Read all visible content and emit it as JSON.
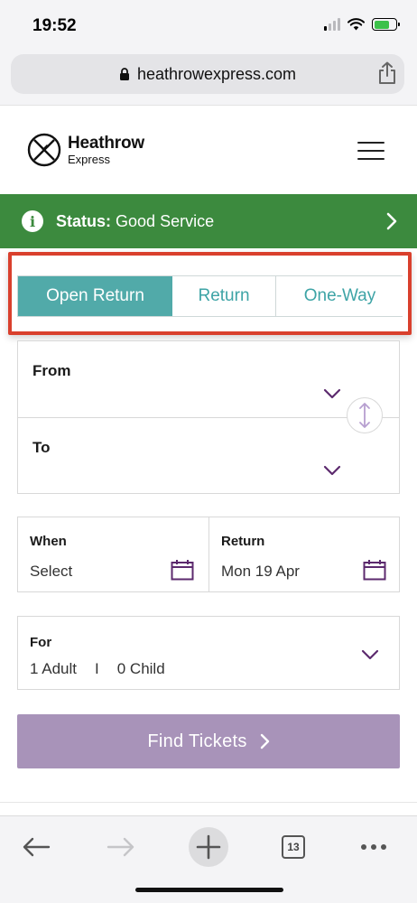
{
  "statusbar": {
    "time": "19:52"
  },
  "browser": {
    "url": "heathrowexpress.com",
    "tab_count": "13"
  },
  "header": {
    "logo_line1": "Heathrow",
    "logo_line2": "Express"
  },
  "status_banner": {
    "label": "Status:",
    "value": "Good Service",
    "color": "#3c8a3e"
  },
  "journey_tabs": [
    {
      "label": "Open Return",
      "selected": true
    },
    {
      "label": "Return",
      "selected": false
    },
    {
      "label": "One-Way",
      "selected": false
    }
  ],
  "form": {
    "from_label": "From",
    "to_label": "To",
    "when_label": "When",
    "when_value": "Select",
    "return_label": "Return",
    "return_value": "Mon 19 Apr",
    "for_label": "For",
    "adults": "1 Adult",
    "separator": "I",
    "children": "0 Child"
  },
  "cta": {
    "label": "Find Tickets",
    "color": "#a893b9"
  },
  "colors": {
    "accent_teal": "#51aaa9",
    "highlight_red": "#d9402d",
    "icon_purple": "#5c2a6e"
  },
  "icons": [
    "lock-icon",
    "share-icon",
    "logo-icon",
    "menu-icon",
    "info-icon",
    "chevron-right-icon",
    "chevron-down-icon",
    "swap-icon",
    "calendar-icon",
    "back-icon",
    "forward-icon",
    "plus-icon",
    "tabs-icon",
    "more-icon"
  ]
}
